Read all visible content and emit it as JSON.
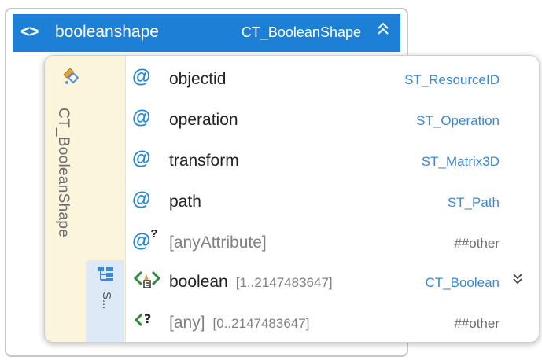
{
  "header": {
    "glyph": "<>",
    "name": "booleanshape",
    "type": "CT_BooleanShape",
    "collapse_glyph": "≈"
  },
  "panel": {
    "type_label": "CT_BooleanShape",
    "sequence_label": "S..."
  },
  "attributes": [
    {
      "icon": "@",
      "name": "objectid",
      "type": "ST_ResourceID"
    },
    {
      "icon": "@",
      "name": "operation",
      "type": "ST_Operation"
    },
    {
      "icon": "@",
      "name": "transform",
      "type": "ST_Matrix3D"
    },
    {
      "icon": "@",
      "name": "path",
      "type": "ST_Path"
    },
    {
      "icon": "@",
      "icon_sup": "?",
      "name": "[anyAttribute]",
      "type": "##other"
    }
  ],
  "elements": [
    {
      "name": "boolean",
      "cardinality": "[1..2147483647]",
      "type": "CT_Boolean",
      "expand_glyph": "≈"
    },
    {
      "name": "[any]",
      "cardinality": "[0..2147483647]",
      "type": "##other"
    }
  ],
  "colors": {
    "header_bg": "#1e7fd6",
    "side_bg": "#fbf5dc",
    "sequence_bg": "#dde9f6",
    "type_text": "#3c86cf",
    "icon_blue": "#1f86d6",
    "element_icon_green": "#2e8b3e"
  },
  "icons": {
    "header": "element-brackets-icon",
    "type": "complex-type-icon",
    "sequence": "sequence-tree-icon",
    "attribute": "attribute-at-icon",
    "any_attribute": "any-attribute-icon",
    "element": "element-with-children-icon",
    "any_element": "any-element-icon"
  }
}
